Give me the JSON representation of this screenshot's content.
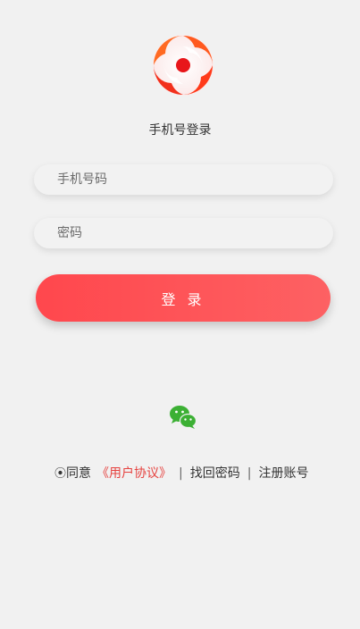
{
  "header": {
    "title": "手机号登录",
    "logo_icon": "logo-swirl-icon"
  },
  "form": {
    "phone_placeholder": "手机号码",
    "phone_value": "",
    "password_placeholder": "密码",
    "password_value": "",
    "login_label": "登 录"
  },
  "social": {
    "wechat_icon": "wechat-icon"
  },
  "footer": {
    "agree_mark": "⦿",
    "agree_text": "同意",
    "agreement_link": "《用户协议》",
    "separator": "|",
    "find_password": "找回密码",
    "register": "注册账号"
  },
  "colors": {
    "accent": "#ff474d",
    "agreement_link": "#e64340",
    "wechat": "#3cb034"
  }
}
